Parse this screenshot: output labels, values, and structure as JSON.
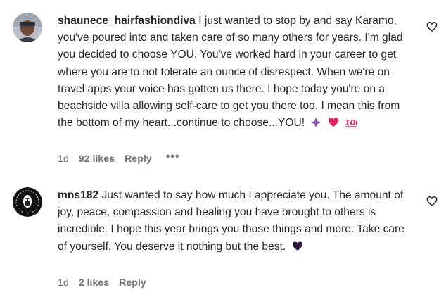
{
  "comments": [
    {
      "username": "shaunece_hairfashiondiva",
      "text": "I just wanted to stop by and say Karamo, you've poured into and taken care of so many others for years. I'm glad you decided to choose YOU. You've worked hard in your career to get where you are to not tolerate an ounce of disrespect. When we're on travel apps your voice has gotten us there. I hope today you're on a beachside villa allowing self-care to get you there too. I mean this from the bottom of my heart...continue to choose...YOU!",
      "emojis": [
        "purple-sparkle-emoji",
        "red-heart-emoji",
        "hundred-points-emoji"
      ],
      "time": "1d",
      "likes": "92 likes",
      "reply_label": "Reply",
      "more_label": "•••"
    },
    {
      "username": "mns182",
      "text": "Just wanted to say how much I appreciate you. The amount of joy, peace, compassion and healing you have brought to others is incredible. I hope this year brings you those things and more. Take care of yourself. You deserve it nothing but the best.",
      "emojis": [
        "black-heart-emoji"
      ],
      "time": "1d",
      "likes": "2 likes",
      "reply_label": "Reply"
    }
  ],
  "colors": {
    "text": "#262626",
    "secondary": "#737373",
    "purple": "#8e44ad",
    "red": "#e0245e"
  },
  "icons": [
    "like-heart-outline-icon",
    "more-options-icon"
  ]
}
